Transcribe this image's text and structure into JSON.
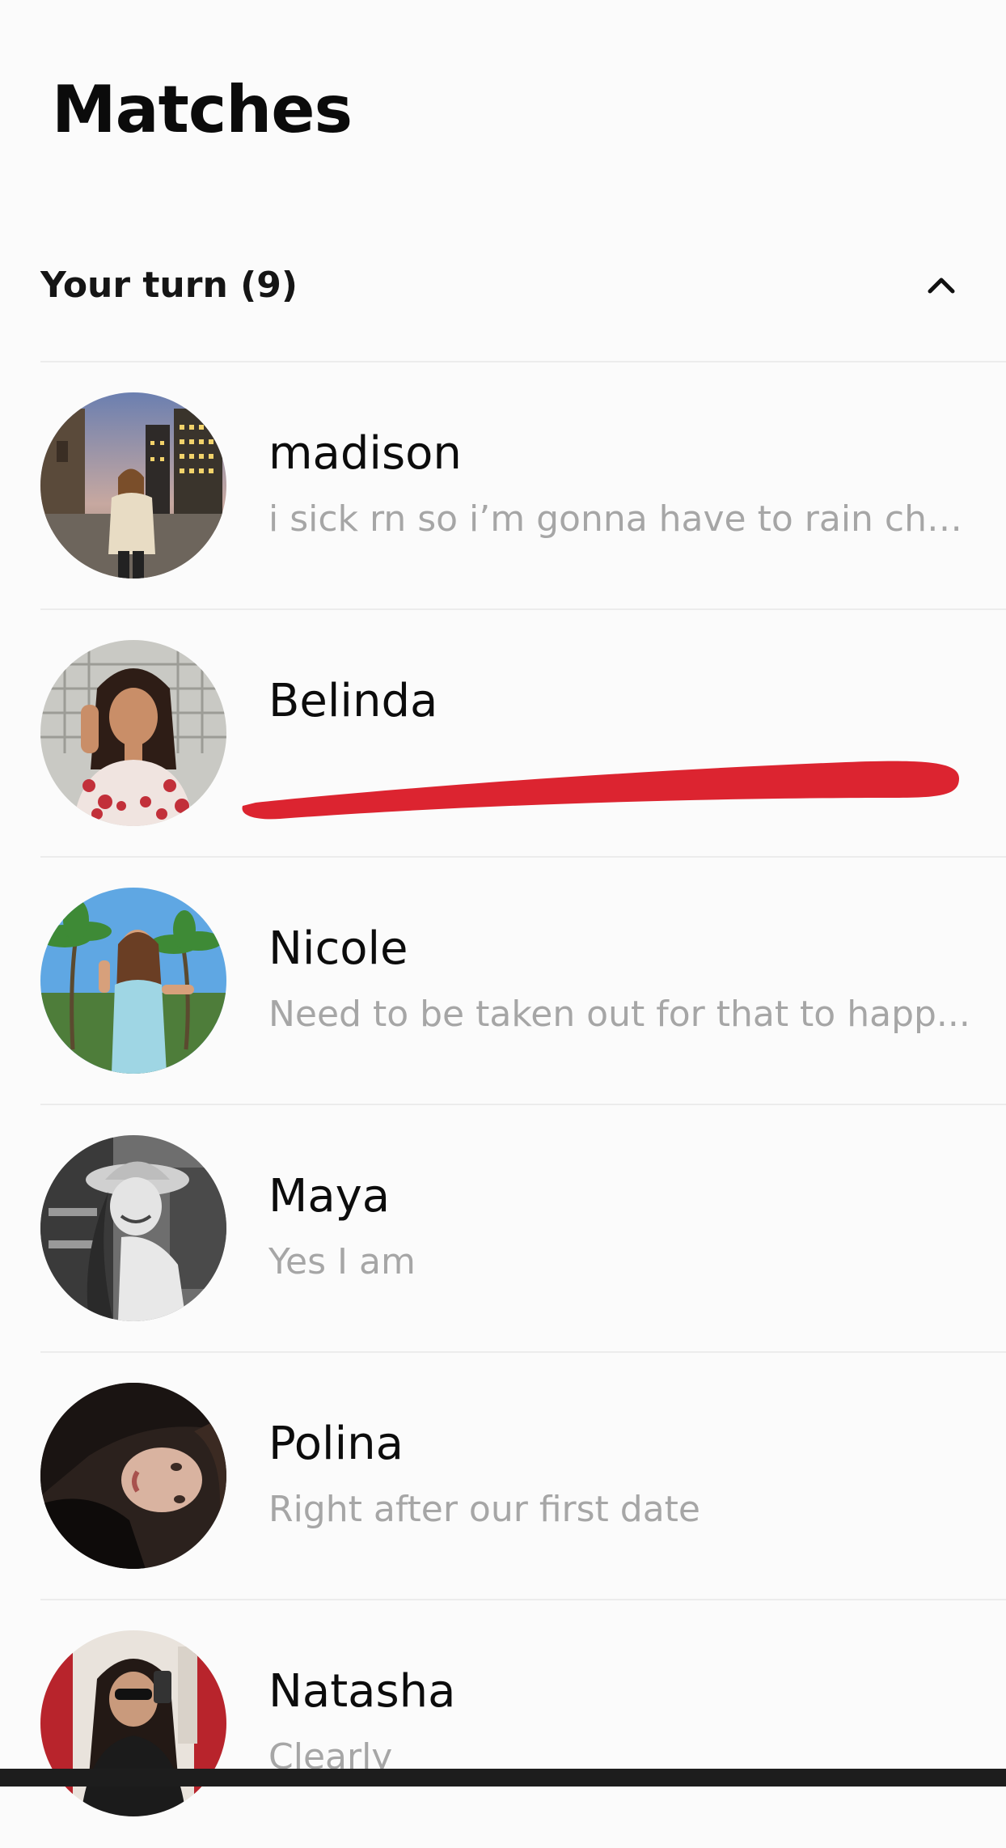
{
  "page": {
    "title": "Matches"
  },
  "section": {
    "title": "Your turn (9)",
    "expanded": true,
    "toggle_icon": "chevron-up-icon"
  },
  "matches": [
    {
      "name": "madison",
      "preview": "i sick rn so i’m gonna have to rain chec...",
      "redacted": false
    },
    {
      "name": "Belinda",
      "preview": "",
      "redacted": true
    },
    {
      "name": "Nicole",
      "preview": "Need to be taken out for that to happ...",
      "redacted": false
    },
    {
      "name": "Maya",
      "preview": "Yes I am",
      "redacted": false
    },
    {
      "name": "Polina",
      "preview": "Right after our first date",
      "redacted": false
    },
    {
      "name": "Natasha",
      "preview": "Clearly",
      "redacted": false
    }
  ],
  "colors": {
    "background": "#fbfbfb",
    "text_primary": "#0c0c0c",
    "text_secondary": "#a6a6a6",
    "divider": "#ececec",
    "redaction": "#dc2430"
  }
}
